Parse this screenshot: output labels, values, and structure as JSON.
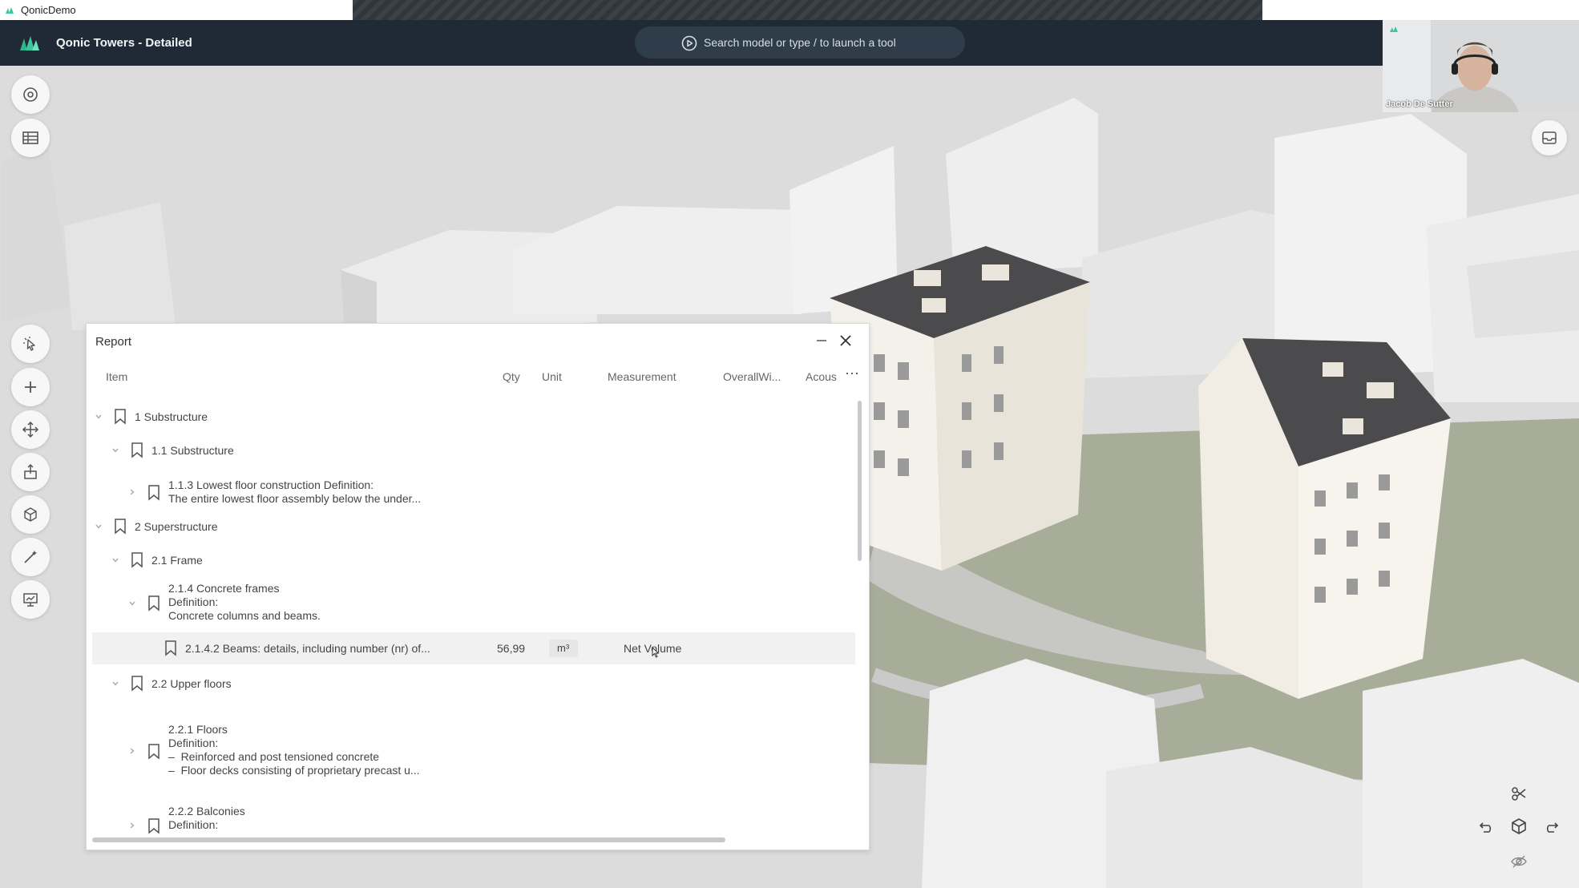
{
  "zoom": {
    "app_name": "QonicDemo"
  },
  "header": {
    "title": "Qonic Towers - Detailed",
    "search_placeholder": "Search model or type / to launch a tool"
  },
  "webcam": {
    "name": "Jacob De Sutter"
  },
  "colors": {
    "header_bg": "#1f2a36",
    "accent": "#3cc6a0",
    "panel_bg": "#ffffff",
    "selected_row": "#f1f1f1"
  },
  "toolbar": {
    "top_tools": [
      "search-zoom-icon",
      "table-icon"
    ],
    "tools": [
      "select-cursor-icon",
      "add-icon",
      "move-icon",
      "extrude-icon",
      "object-3d-icon",
      "edit-wand-icon",
      "presentation-icon"
    ]
  },
  "report": {
    "title": "Report",
    "columns": {
      "item": "Item",
      "qty": "Qty",
      "unit": "Unit",
      "measurement": "Measurement",
      "overall": "OverallWi...",
      "acous": "Acous"
    },
    "rows": [
      {
        "label": "1 Substructure"
      },
      {
        "label": "1.1 Substructure"
      },
      {
        "label": "1.1.3 Lowest floor construction Definition:\nThe entire lowest floor assembly below the under..."
      },
      {
        "label": "2 Superstructure"
      },
      {
        "label": "2.1 Frame"
      },
      {
        "label": "2.1.4 Concrete frames\nDefinition:\nConcrete columns and beams."
      },
      {
        "label": "2.1.4.2 Beams: details, including number (nr) of...",
        "qty": "56,99",
        "unit": "m³",
        "measurement": "Net Volume"
      },
      {
        "label": "2.2 Upper floors"
      },
      {
        "label": "2.2.1 Floors\nDefinition:\n–  Reinforced and post tensioned concrete\n–  Floor decks consisting of proprietary precast u..."
      },
      {
        "label": "2.2.2 Balconies\nDefinition:"
      }
    ]
  }
}
